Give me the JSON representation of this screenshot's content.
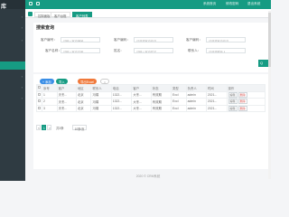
{
  "sidebar": {
    "logo": "库",
    "items": [
      {
        "label": "库"
      },
      {
        "label": ""
      },
      {
        "label": ""
      },
      {
        "label": ""
      },
      {
        "label": ""
      },
      {
        "label": ""
      },
      {
        "label": ""
      },
      {
        "label": ""
      }
    ]
  },
  "topbar": {
    "links": [
      "系统首页",
      "修改密码",
      "退出系统"
    ]
  },
  "tabs": [
    "控制面板",
    "客户台账",
    "客户列表"
  ],
  "query": {
    "title": "搜索查询",
    "labels": [
      "客户编号：",
      "客户名称：",
      "客户编码：",
      "姓名：",
      "客户编码：",
      "联系人："
    ],
    "placeholders": [
      "请输入客户编号",
      "请输入客户名称",
      "请选择客户信息",
      "请输入客户姓名",
      "请选择客户信息",
      "请选择联系人"
    ],
    "search_label": "Q"
  },
  "toolbar": {
    "add": "+ 添加",
    "import": "导入",
    "export": "导出Excel"
  },
  "table": {
    "headers": [
      "序号",
      "客户",
      "地区",
      "联系人",
      "电话",
      "客户",
      "状态",
      "类型",
      "负责人",
      "时间",
      "操作"
    ],
    "rows": [
      [
        "1",
        "天冬...",
        "北京",
        "冯娟",
        "1322...",
        "大冬...",
        "有效期",
        "Excl",
        "admin",
        "2021...",
        ""
      ],
      [
        "2",
        "天冬...",
        "北京",
        "冯娟",
        "1322...",
        "大冬...",
        "有效期",
        "Excl",
        "admin",
        "2021...",
        ""
      ],
      [
        "3",
        "天冬...",
        "北京",
        "冯娟",
        "1322...",
        "大冬...",
        "有效期",
        "Excl",
        "admin",
        "2021...",
        ""
      ]
    ],
    "row_edit": "编辑",
    "row_delete": "删除"
  },
  "pager": {
    "prev": "<",
    "current": "1",
    "next": ">",
    "total": "共3条",
    "size": "10条/页"
  },
  "footer": "2020 © CRM系统",
  "colors": {
    "accent": "#169b83",
    "sidebar": "#2f3b42"
  }
}
